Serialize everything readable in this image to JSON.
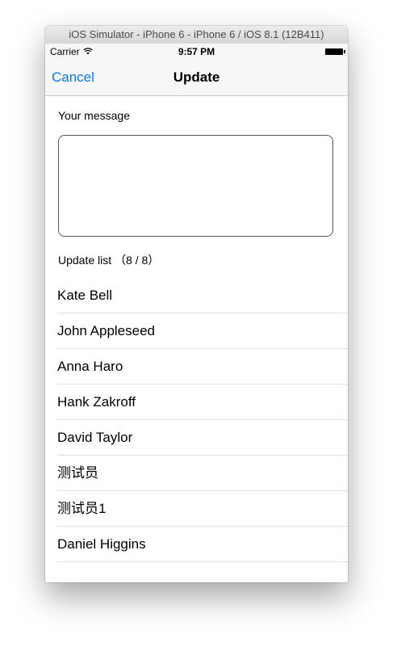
{
  "window": {
    "title": "iOS Simulator - iPhone 6 - iPhone 6 / iOS 8.1 (12B411)"
  },
  "status_bar": {
    "carrier": "Carrier",
    "time": "9:57 PM",
    "icons": [
      "wifi-icon",
      "battery-icon"
    ]
  },
  "nav": {
    "cancel_label": "Cancel",
    "title": "Update"
  },
  "form": {
    "message_label": "Your message",
    "message_value": ""
  },
  "list": {
    "header": "Update list （8 / 8）",
    "items": [
      "Kate Bell",
      "John Appleseed",
      "Anna Haro",
      "Hank Zakroff",
      "David Taylor",
      "测试员",
      "测试员1",
      "Daniel Higgins"
    ]
  },
  "colors": {
    "accent": "#007aff",
    "bar_background": "#f7f7f7",
    "separator": "#c8c7cc"
  }
}
